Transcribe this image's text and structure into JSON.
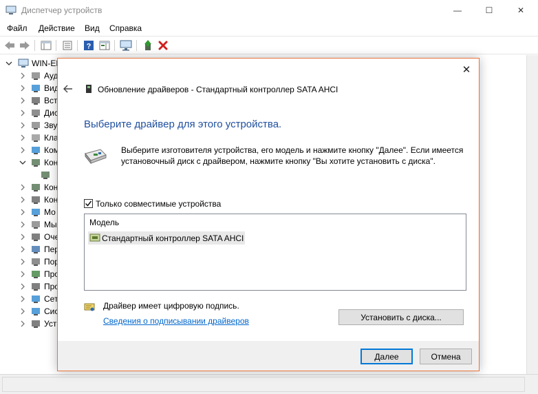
{
  "window": {
    "title": "Диспетчер устройств",
    "minimize_glyph": "—",
    "maximize_glyph": "☐",
    "close_glyph": "✕"
  },
  "menu": [
    "Файл",
    "Действие",
    "Вид",
    "Справка"
  ],
  "tree": {
    "root": "WIN-EF",
    "items": [
      {
        "label": "Ауд",
        "icon": "speaker-icon"
      },
      {
        "label": "Вид",
        "icon": "display-adapter-icon"
      },
      {
        "label": "Вст",
        "icon": "firmware-icon"
      },
      {
        "label": "Дис",
        "icon": "disk-drive-icon"
      },
      {
        "label": "Зву",
        "icon": "sound-icon"
      },
      {
        "label": "Кла",
        "icon": "keyboard-icon"
      },
      {
        "label": "Ком",
        "icon": "computer-icon"
      },
      {
        "label": "Кон",
        "icon": "ide-controller-icon",
        "expanded": true
      },
      {
        "label": "",
        "icon": "controller-child-icon",
        "child": true
      },
      {
        "label": "Кон",
        "icon": "controller-icon"
      },
      {
        "label": "Кон",
        "icon": "usb-controller-icon"
      },
      {
        "label": "Мо",
        "icon": "monitor-icon"
      },
      {
        "label": "Мы",
        "icon": "mouse-icon"
      },
      {
        "label": "Оче",
        "icon": "print-queue-icon"
      },
      {
        "label": "Пер",
        "icon": "portable-device-icon"
      },
      {
        "label": "Пор",
        "icon": "port-icon"
      },
      {
        "label": "Про",
        "icon": "processor-icon"
      },
      {
        "label": "Про",
        "icon": "software-device-icon"
      },
      {
        "label": "Сет",
        "icon": "network-adapter-icon"
      },
      {
        "label": "Сис",
        "icon": "system-device-icon"
      },
      {
        "label": "Уст",
        "icon": "hid-device-icon"
      }
    ]
  },
  "dialog": {
    "header": "Обновление драйверов - Стандартный контроллер SATA AHCI",
    "heading": "Выберите драйвер для этого устройства.",
    "description": "Выберите изготовителя устройства, его модель и нажмите кнопку \"Далее\". Если имеется установочный диск с  драйвером, нажмите кнопку \"Вы хотите установить с диска\".",
    "checkbox_label": "Только совместимые устройства",
    "checkbox_checked": true,
    "list_header": "Модель",
    "list_items": [
      "Стандартный контроллер SATA AHCI"
    ],
    "signature_text": "Драйвер имеет цифровую подпись.",
    "signature_link": "Сведения о подписывании драйверов",
    "install_button": "Установить с диска...",
    "next_button": "Далее",
    "cancel_button": "Отмена",
    "close_glyph": "✕",
    "accent_color": "#e8743b",
    "heading_color": "#1f4f9f",
    "link_color": "#0066cc"
  }
}
